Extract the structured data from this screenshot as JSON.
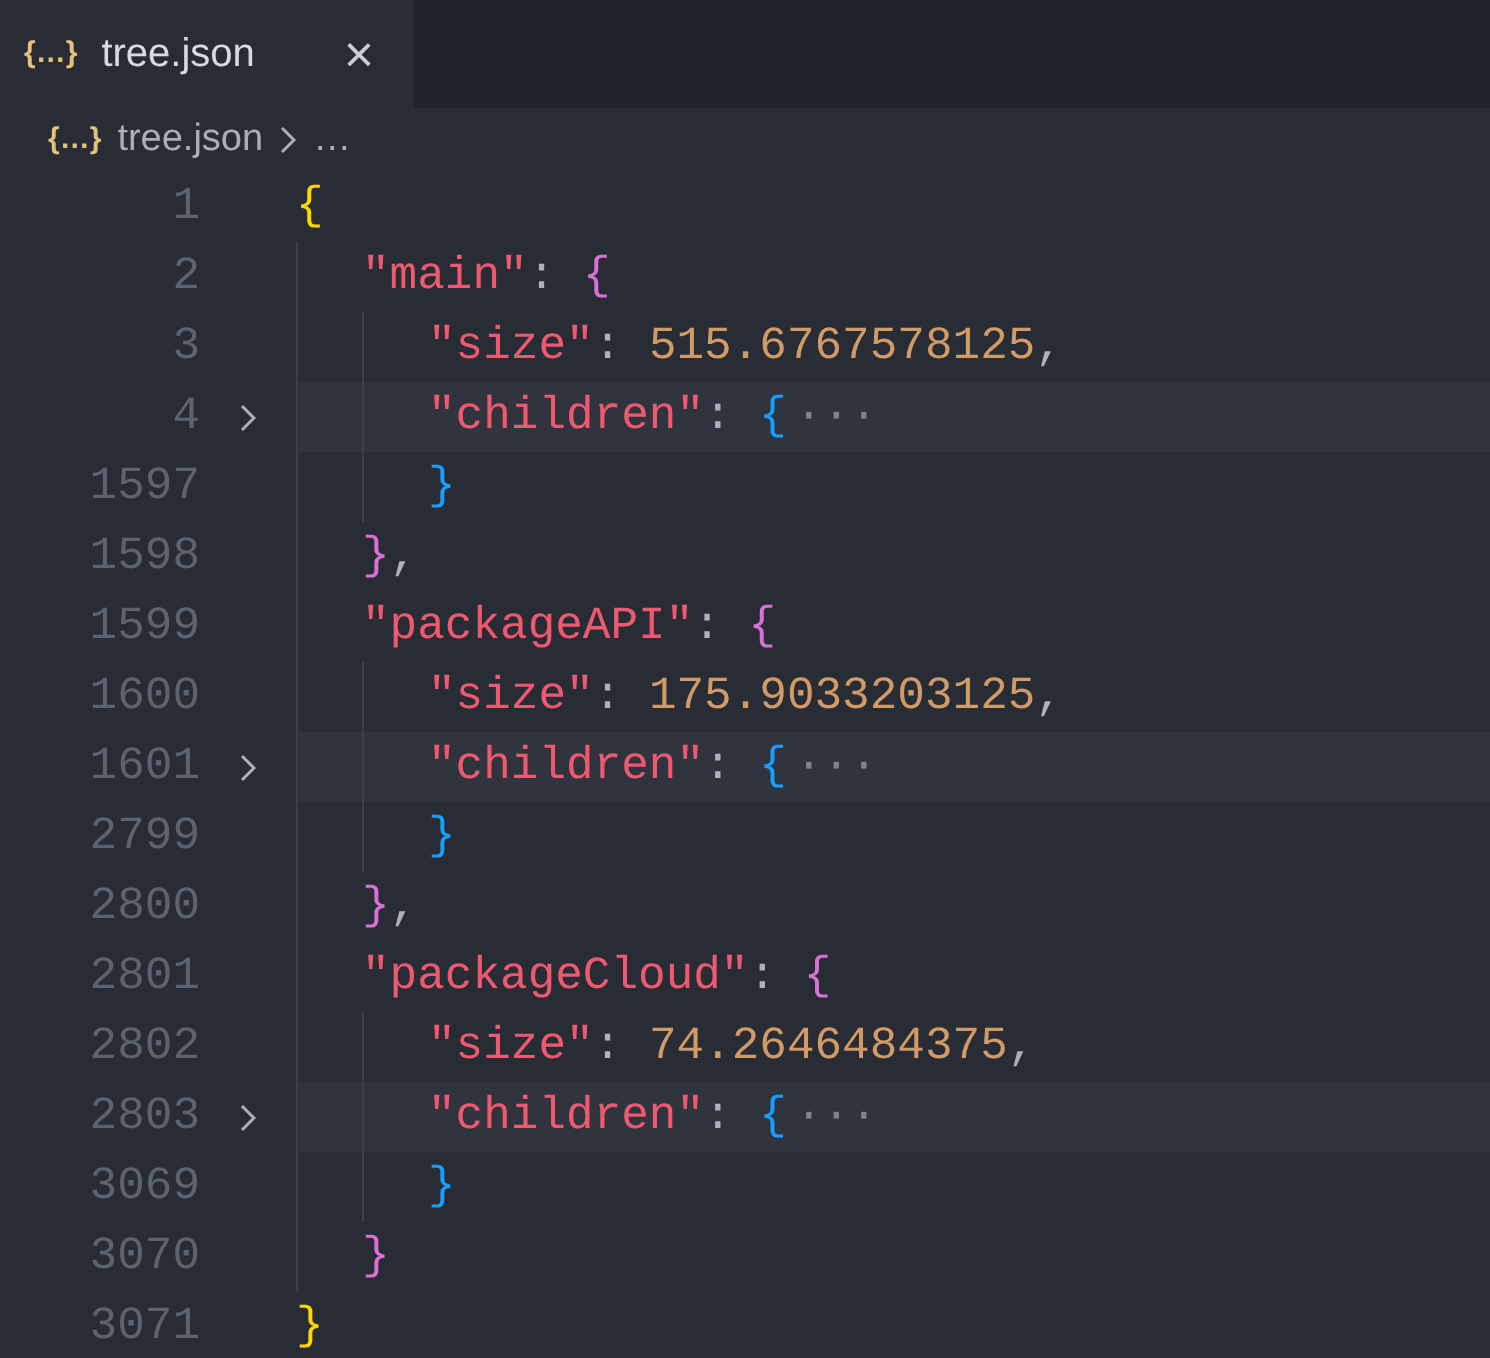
{
  "tabs": [
    {
      "icon": "{…}",
      "label": "tree.json",
      "close": "×",
      "selected": true
    }
  ],
  "breadcrumb": {
    "icon": "{…}",
    "file": "tree.json",
    "rest": "…"
  },
  "lines": [
    {
      "number": "1",
      "tokens": [
        {
          "kind": "brace",
          "text": "{",
          "color": "#ffd700"
        }
      ],
      "children": [
        {
          "number": "2",
          "tokens": [
            {
              "kind": "key",
              "text": "\"main\""
            },
            {
              "kind": "punct",
              "text": ": "
            },
            {
              "kind": "brace",
              "text": "{",
              "color": "#da70d6"
            }
          ],
          "children": [
            {
              "number": "3",
              "tokens": [
                {
                  "kind": "key",
                  "text": "\"size\""
                },
                {
                  "kind": "punct",
                  "text": ": "
                },
                {
                  "kind": "number",
                  "text": "515.6767578125"
                },
                {
                  "kind": "punct",
                  "text": ","
                }
              ]
            },
            {
              "number": "4",
              "folded": true,
              "tokens": [
                {
                  "kind": "key",
                  "text": "\"children\""
                },
                {
                  "kind": "punct",
                  "text": ": "
                },
                {
                  "kind": "brace",
                  "text": "{",
                  "color": "#179fff"
                },
                {
                  "kind": "ellipsis",
                  "text": "···"
                }
              ]
            },
            {
              "number": "1597",
              "tokens": [
                {
                  "kind": "brace",
                  "text": "}",
                  "color": "#179fff"
                }
              ]
            }
          ]
        },
        {
          "number": "1598",
          "tokens": [
            {
              "kind": "brace",
              "text": "}",
              "color": "#da70d6"
            },
            {
              "kind": "punct",
              "text": ","
            }
          ]
        },
        {
          "number": "1599",
          "tokens": [
            {
              "kind": "key",
              "text": "\"packageAPI\""
            },
            {
              "kind": "punct",
              "text": ": "
            },
            {
              "kind": "brace",
              "text": "{",
              "color": "#da70d6"
            }
          ],
          "children": [
            {
              "number": "1600",
              "tokens": [
                {
                  "kind": "key",
                  "text": "\"size\""
                },
                {
                  "kind": "punct",
                  "text": ": "
                },
                {
                  "kind": "number",
                  "text": "175.9033203125"
                },
                {
                  "kind": "punct",
                  "text": ","
                }
              ]
            },
            {
              "number": "1601",
              "folded": true,
              "tokens": [
                {
                  "kind": "key",
                  "text": "\"children\""
                },
                {
                  "kind": "punct",
                  "text": ": "
                },
                {
                  "kind": "brace",
                  "text": "{",
                  "color": "#179fff"
                },
                {
                  "kind": "ellipsis",
                  "text": "···"
                }
              ]
            },
            {
              "number": "2799",
              "tokens": [
                {
                  "kind": "brace",
                  "text": "}",
                  "color": "#179fff"
                }
              ]
            }
          ]
        },
        {
          "number": "2800",
          "tokens": [
            {
              "kind": "brace",
              "text": "}",
              "color": "#da70d6"
            },
            {
              "kind": "punct",
              "text": ","
            }
          ]
        },
        {
          "number": "2801",
          "tokens": [
            {
              "kind": "key",
              "text": "\"packageCloud\""
            },
            {
              "kind": "punct",
              "text": ": "
            },
            {
              "kind": "brace",
              "text": "{",
              "color": "#da70d6"
            }
          ],
          "children": [
            {
              "number": "2802",
              "tokens": [
                {
                  "kind": "key",
                  "text": "\"size\""
                },
                {
                  "kind": "punct",
                  "text": ": "
                },
                {
                  "kind": "number",
                  "text": "74.2646484375"
                },
                {
                  "kind": "punct",
                  "text": ","
                }
              ]
            },
            {
              "number": "2803",
              "folded": true,
              "tokens": [
                {
                  "kind": "key",
                  "text": "\"children\""
                },
                {
                  "kind": "punct",
                  "text": ": "
                },
                {
                  "kind": "brace",
                  "text": "{",
                  "color": "#179fff"
                },
                {
                  "kind": "ellipsis",
                  "text": "···"
                }
              ]
            },
            {
              "number": "3069",
              "tokens": [
                {
                  "kind": "brace",
                  "text": "}",
                  "color": "#179fff"
                }
              ]
            }
          ]
        },
        {
          "number": "3070",
          "tokens": [
            {
              "kind": "brace",
              "text": "}",
              "color": "#da70d6"
            }
          ]
        }
      ]
    },
    {
      "number": "3071",
      "tokens": [
        {
          "kind": "brace",
          "text": "}",
          "color": "#ffd700"
        }
      ]
    }
  ]
}
